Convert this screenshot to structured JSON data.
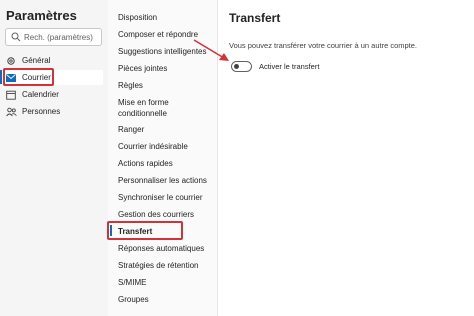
{
  "app_title": "Paramètres",
  "search": {
    "placeholder": "Rech. (paramètres)"
  },
  "nav": [
    {
      "label": "Général",
      "icon": "gear-icon"
    },
    {
      "label": "Courrier",
      "icon": "mail-icon"
    },
    {
      "label": "Calendrier",
      "icon": "calendar-icon"
    },
    {
      "label": "Personnes",
      "icon": "people-icon"
    }
  ],
  "submenu": [
    "Disposition",
    "Composer et répondre",
    "Suggestions intelligentes",
    "Pièces jointes",
    "Règles",
    "Mise en forme conditionnelle",
    "Ranger",
    "Courrier indésirable",
    "Actions rapides",
    "Personnaliser les actions",
    "Synchroniser le courrier",
    "Gestion des courriers",
    "Transfert",
    "Réponses automatiques",
    "Stratégies de rétention",
    "S/MIME",
    "Groupes"
  ],
  "panel": {
    "title": "Transfert",
    "description": "Vous pouvez transférer votre courrier à un autre compte.",
    "toggle_label": "Activer le transfert",
    "toggle_on": false
  },
  "colors": {
    "accent": "#0f6cbd",
    "highlight": "#d13438"
  }
}
